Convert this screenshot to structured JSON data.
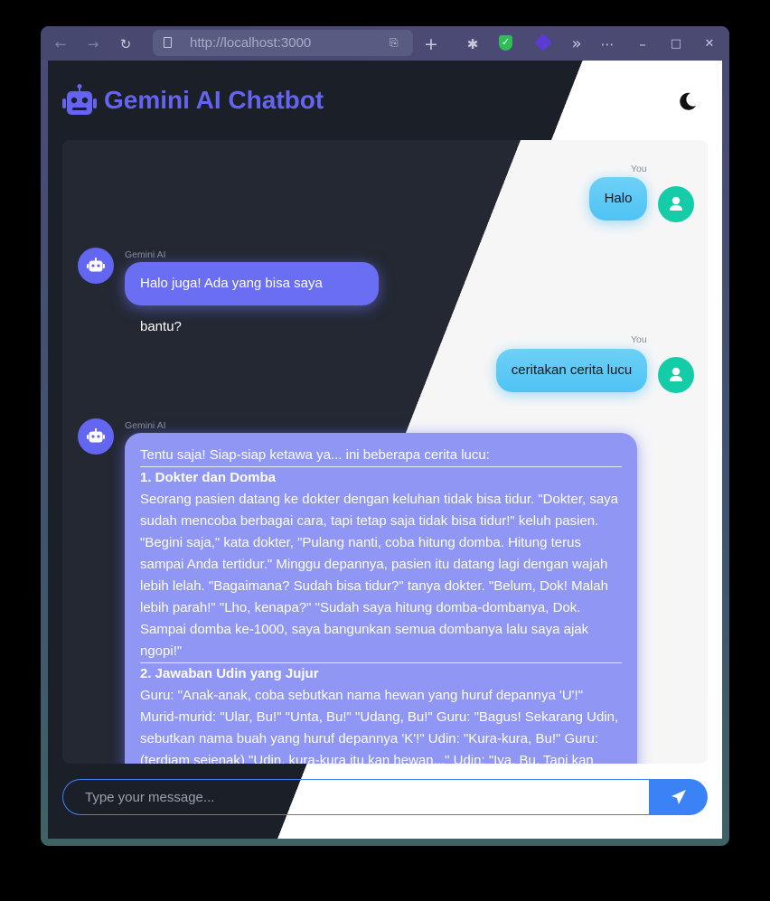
{
  "browser": {
    "url": "http://localhost:3000",
    "icons": [
      "back-arrow-icon",
      "forward-arrow-icon",
      "reload-icon",
      "page-icon",
      "reader-view-icon",
      "new-tab-plus-icon",
      "extensions-puzzle-icon",
      "shield-extension-icon",
      "violet-extension-icon",
      "overflow-chevrons-icon",
      "more-dots-icon",
      "minimize-icon",
      "maximize-icon",
      "close-icon"
    ],
    "glyphs": {
      "back": "←",
      "forward": "→",
      "reload": "↻",
      "reader": "⎘",
      "new_tab": "+",
      "puzzle": "✱",
      "shield_check": "✓",
      "overflow": "»",
      "more": "⋯",
      "minimize": "–",
      "maximize": "□",
      "close": "✕"
    }
  },
  "app": {
    "title": "Gemini AI Chatbot",
    "theme_toggle_icon": "moon-icon",
    "accent": "#6464f0"
  },
  "messages": [
    {
      "sender": "You",
      "role": "user",
      "text": "Halo"
    },
    {
      "sender": "Gemini AI",
      "role": "bot",
      "text": "Halo juga! Ada yang bisa saya bantu?"
    },
    {
      "sender": "You",
      "role": "user",
      "text": "ceritakan cerita lucu"
    },
    {
      "sender": "Gemini AI",
      "role": "bot",
      "intro": "Tentu saja! Siap-siap ketawa ya... ini beberapa cerita lucu:",
      "story1_title": "1. Dokter dan Domba",
      "story1_body": "Seorang pasien datang ke dokter dengan keluhan tidak bisa tidur. \"Dokter, saya sudah mencoba berbagai cara, tapi tetap saja tidak bisa tidur!\" keluh pasien. \"Begini saja,\" kata dokter, \"Pulang nanti, coba hitung domba. Hitung terus sampai Anda tertidur.\" Minggu depannya, pasien itu datang lagi dengan wajah lebih lelah. \"Bagaimana? Sudah bisa tidur?\" tanya dokter. \"Belum, Dok! Malah lebih parah!\" \"Lho, kenapa?\" \"Sudah saya hitung domba-dombanya, Dok. Sampai domba ke-1000, saya bangunkan semua dombanya lalu saya ajak ngopi!\"",
      "story2_title": "2. Jawaban Udin yang Jujur",
      "story2_body": "Guru: \"Anak-anak, coba sebutkan nama hewan yang huruf depannya 'U'!\" Murid-murid: \"Ular, Bu!\" \"Unta, Bu!\" \"Udang, Bu!\" Guru: \"Bagus! Sekarang Udin, sebutkan nama buah yang huruf depannya 'K'!\" Udin: \"Kura-kura, Bu!\" Guru: (terdiam sejenak) \"Udin, kura-kura itu kan hewan...\" Udin: \"Iya, Bu. Tapi kan"
    }
  ],
  "composer": {
    "placeholder": "Type your message...",
    "send_icon": "paper-plane-icon"
  },
  "colors": {
    "user_bubble": "#5ec9f5",
    "bot_bubble": "#6a6ef2",
    "user_avatar": "#14cca8",
    "bot_avatar": "#6366f1",
    "send_button": "#3b82f6"
  }
}
